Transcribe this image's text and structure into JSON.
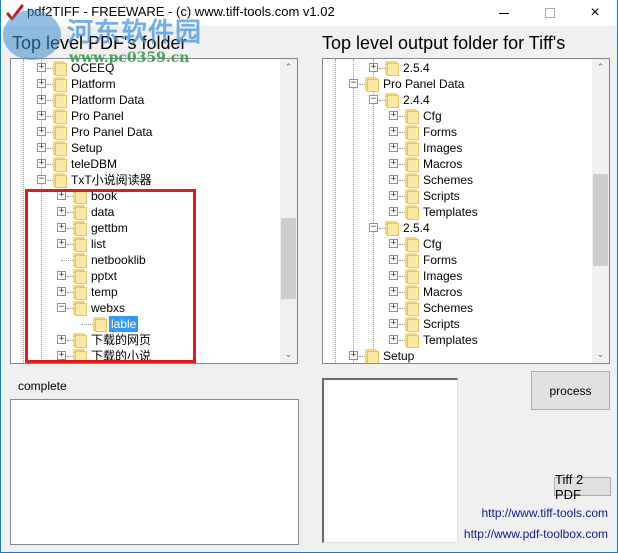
{
  "window": {
    "title": "pdf2TIFF - FREEWARE - (c) www.tiff-tools.com v1.02",
    "app_icon": "red-checkmark-icon",
    "controls": {
      "minimize": "minimize-icon",
      "maximize": "maximize-icon",
      "close": "×"
    }
  },
  "watermark": {
    "text": "河东软件园",
    "url": "www.pc0359.cn"
  },
  "left_panel": {
    "title": "Top level PDF's folder",
    "tree": [
      {
        "label": "OCEEQ",
        "level": 1,
        "expander": "+"
      },
      {
        "label": "Platform",
        "level": 1,
        "expander": "+"
      },
      {
        "label": "Platform Data",
        "level": 1,
        "expander": "+"
      },
      {
        "label": "Pro Panel",
        "level": 1,
        "expander": "+"
      },
      {
        "label": "Pro Panel Data",
        "level": 1,
        "expander": "+"
      },
      {
        "label": "Setup",
        "level": 1,
        "expander": "+"
      },
      {
        "label": "teleDBM",
        "level": 1,
        "expander": "+"
      },
      {
        "label": "TxT小说阅读器",
        "level": 1,
        "expander": "-"
      },
      {
        "label": "book",
        "level": 2,
        "expander": "+"
      },
      {
        "label": "data",
        "level": 2,
        "expander": "+"
      },
      {
        "label": "gettbm",
        "level": 2,
        "expander": "+"
      },
      {
        "label": "list",
        "level": 2,
        "expander": "+"
      },
      {
        "label": "netbooklib",
        "level": 2,
        "expander": ""
      },
      {
        "label": "pptxt",
        "level": 2,
        "expander": "+"
      },
      {
        "label": "temp",
        "level": 2,
        "expander": "+"
      },
      {
        "label": "webxs",
        "level": 2,
        "expander": "-"
      },
      {
        "label": "lable",
        "level": 3,
        "expander": "",
        "selected": true
      },
      {
        "label": "下载的网页",
        "level": 2,
        "expander": "+"
      },
      {
        "label": "下载的小说",
        "level": 2,
        "expander": "+"
      }
    ],
    "scroll": {
      "position_fraction": 0.75,
      "visible_fraction": 0.3
    }
  },
  "right_panel": {
    "title": "Top level output folder for Tiff's",
    "tree": [
      {
        "label": "2.5.4",
        "level": 2,
        "expander": "+"
      },
      {
        "label": "Pro Panel Data",
        "level": 1,
        "expander": "-"
      },
      {
        "label": "2.4.4",
        "level": 2,
        "expander": "-"
      },
      {
        "label": "Cfg",
        "level": 3,
        "expander": "+"
      },
      {
        "label": "Forms",
        "level": 3,
        "expander": "+"
      },
      {
        "label": "Images",
        "level": 3,
        "expander": "+"
      },
      {
        "label": "Macros",
        "level": 3,
        "expander": "+"
      },
      {
        "label": "Schemes",
        "level": 3,
        "expander": "+"
      },
      {
        "label": "Scripts",
        "level": 3,
        "expander": "+"
      },
      {
        "label": "Templates",
        "level": 3,
        "expander": "+"
      },
      {
        "label": "2.5.4",
        "level": 2,
        "expander": "-"
      },
      {
        "label": "Cfg",
        "level": 3,
        "expander": "+"
      },
      {
        "label": "Forms",
        "level": 3,
        "expander": "+"
      },
      {
        "label": "Images",
        "level": 3,
        "expander": "+"
      },
      {
        "label": "Macros",
        "level": 3,
        "expander": "+"
      },
      {
        "label": "Schemes",
        "level": 3,
        "expander": "+"
      },
      {
        "label": "Scripts",
        "level": 3,
        "expander": "+"
      },
      {
        "label": "Templates",
        "level": 3,
        "expander": "+"
      },
      {
        "label": "Setup",
        "level": 1,
        "expander": "+"
      }
    ],
    "scroll": {
      "position_fraction": 0.55,
      "visible_fraction": 0.34
    }
  },
  "status": {
    "label": "complete",
    "log": ""
  },
  "buttons": {
    "process": "process",
    "tiff2pdf": "Tiff 2 PDF"
  },
  "links": {
    "tiff_tools": "http://www.tiff-tools.com",
    "pdf_toolbox": "http://www.pdf-toolbox.com"
  },
  "colors": {
    "selection": "#3399ff",
    "highlight_box": "#e11b1b",
    "link": "#0a1a8a",
    "folder": "#f8d775"
  }
}
